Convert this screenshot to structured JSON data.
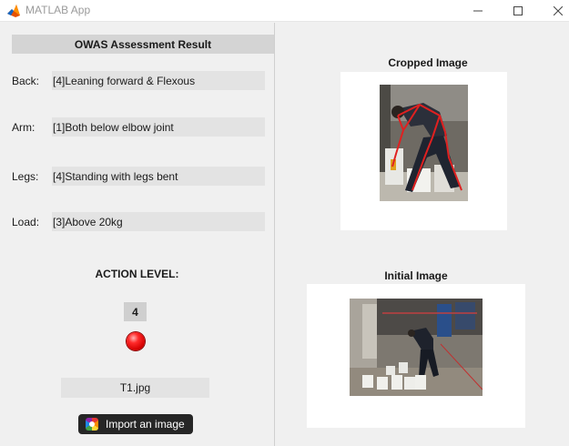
{
  "window": {
    "title": "MATLAB App"
  },
  "result": {
    "header": "OWAS Assessment Result",
    "rows": [
      {
        "label": "Back:",
        "value": "[4]Leaning forward & Flexous"
      },
      {
        "label": "Arm:",
        "value": "[1]Both below elbow joint"
      },
      {
        "label": "Legs:",
        "value": "[4]Standing with legs bent"
      },
      {
        "label": "Load:",
        "value": "[3]Above 20kg"
      }
    ],
    "action_label": "ACTION LEVEL:",
    "action_value": "4",
    "lamp_color": "#e00000",
    "filename": "T1.jpg",
    "import_button": "Import an image"
  },
  "images": {
    "cropped_title": "Cropped Image",
    "initial_title": "Initial Image",
    "skeleton_color": "#e02020"
  }
}
